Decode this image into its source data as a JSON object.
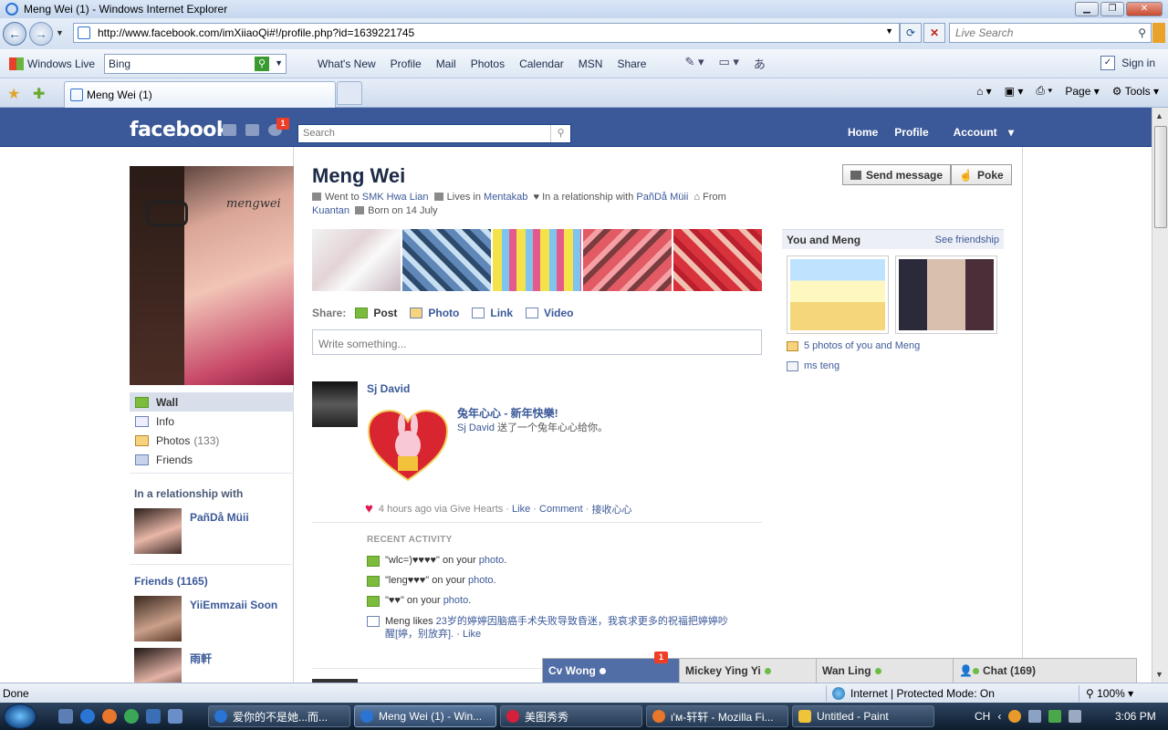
{
  "browser": {
    "window_title": "Meng Wei (1) - Windows Internet Explorer",
    "url": "http://www.facebook.com/imXiiaoQi#!/profile.php?id=1639221745",
    "live_search_placeholder": "Live Search",
    "windows_live_label": "Windows Live",
    "bing_value": "Bing",
    "links": [
      "What's New",
      "Profile",
      "Mail",
      "Photos",
      "Calendar",
      "MSN",
      "Share"
    ],
    "signin": "Sign in",
    "tab_title": "Meng Wei (1)",
    "cmd_page": "Page",
    "cmd_tools": "Tools",
    "status_done": "Done",
    "status_zone": "Internet | Protected Mode: On",
    "zoom": "100%"
  },
  "facebook": {
    "logo": "facebook",
    "notification_count": "1",
    "search_placeholder": "Search",
    "nav": [
      "Home",
      "Profile",
      "Account"
    ]
  },
  "profile": {
    "name": "Meng Wei",
    "signature": "mengwei",
    "send_message": "Send message",
    "poke": "Poke",
    "went_to_label": "Went to",
    "school": "SMK Hwa Lian",
    "lives_label": "Lives in",
    "lives": "Mentakab",
    "relationship_label": "In a relationship with",
    "partner": "PañDå Müii",
    "from_label": "From",
    "hometown": "Kuantan",
    "born": "Born on 14 July"
  },
  "left_nav": {
    "wall": "Wall",
    "info": "Info",
    "photos": "Photos",
    "photos_count": "(133)",
    "friends": "Friends",
    "relationship_title": "In a relationship with",
    "partner_name": "PañDå Müii",
    "friends_title": "Friends",
    "friends_count": "(1165)",
    "friend1": "YiiEmmzaii Soon",
    "friend2": "雨軒"
  },
  "share": {
    "label": "Share:",
    "post": "Post",
    "photo": "Photo",
    "link": "Link",
    "video": "Video",
    "placeholder": "Write something..."
  },
  "story": {
    "author": "Sj David",
    "gift_title": "兔年心心 - 新年快樂!",
    "gift_author": "Sj David",
    "gift_text": "送了一个兔年心心给你。",
    "time_via": "4 hours ago via Give Hearts",
    "like": "Like",
    "comment": "Comment",
    "accept": "接收心心"
  },
  "recent_activity": {
    "title": "RECENT ACTIVITY",
    "items": [
      {
        "quote": "\"wlc=)♥♥♥♥\" on your ",
        "link": "photo",
        "end": "."
      },
      {
        "quote": "\"leng♥♥♥\" on your ",
        "link": "photo",
        "end": "."
      },
      {
        "quote": "\"♥♥\" on your ",
        "link": "photo",
        "end": "."
      }
    ],
    "like_prefix": "Meng likes ",
    "like_link": "23岁的婷婷因脑癌手术失败导致昏迷，我哀求更多的祝福把婷婷吵醒[婷，别放弃].",
    "like_action": "Like"
  },
  "you_and": {
    "title": "You and Meng",
    "see": "See friendship",
    "photos_link": "5 photos of you and Meng",
    "music_link": "ms teng"
  },
  "chat": {
    "tab1": "Cv Wong",
    "tab1_badge": "1",
    "tab2": "Mickey Ying Yi",
    "tab3": "Wan Ling",
    "main": "Chat (169)"
  },
  "taskbar": {
    "items": [
      "爱你的不是她...而...",
      "Meng Wei (1) - Win...",
      "美图秀秀",
      "ι'м-轩轩 - Mozilla Fi...",
      "Untitled - Paint"
    ],
    "lang": "CH",
    "time": "3:06 PM"
  }
}
